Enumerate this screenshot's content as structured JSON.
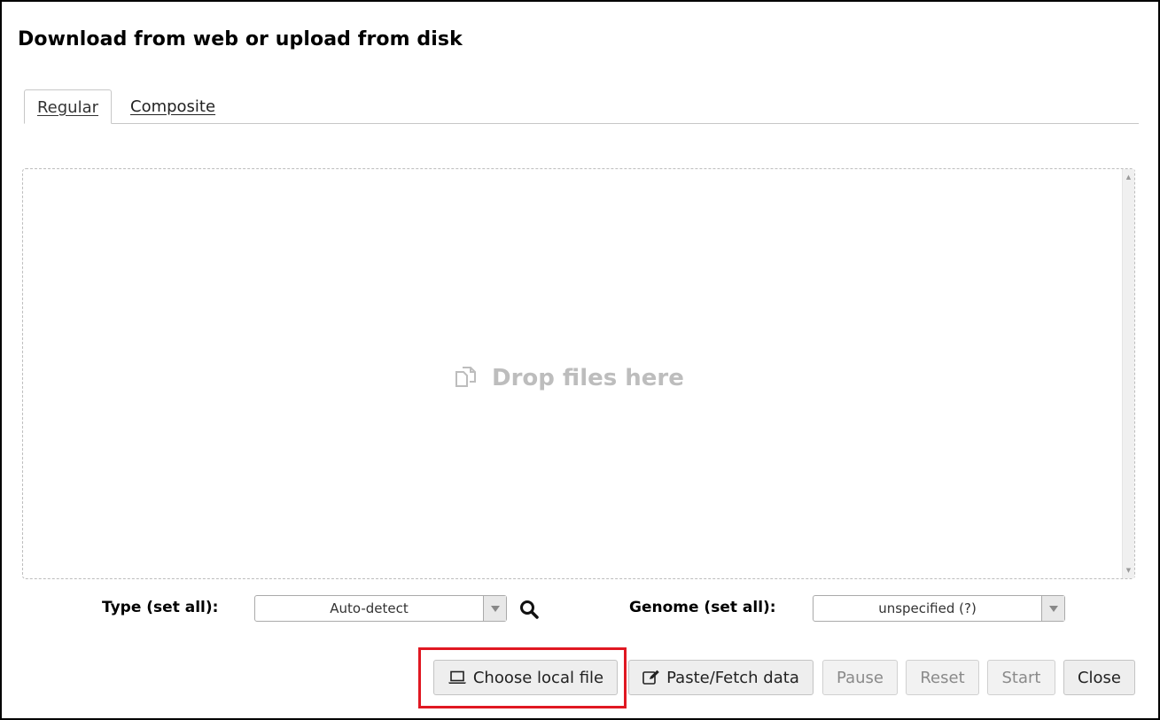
{
  "dialog": {
    "title": "Download from web or upload from disk"
  },
  "tabs": [
    {
      "label": "Regular",
      "active": true
    },
    {
      "label": "Composite",
      "active": false
    }
  ],
  "dropzone": {
    "hint": "Drop files here",
    "icon": "copy-files-icon"
  },
  "type_setting": {
    "label": "Type (set all):",
    "value": "Auto-detect",
    "search_icon": "search-icon"
  },
  "genome_setting": {
    "label": "Genome (set all):",
    "value": "unspecified (?)"
  },
  "buttons": {
    "choose_local_file": "Choose local file",
    "paste_fetch": "Paste/Fetch data",
    "pause": "Pause",
    "reset": "Reset",
    "start": "Start",
    "close": "Close"
  },
  "colors": {
    "highlight": "#e01822",
    "hint_text": "#bdbdbd",
    "button_bg": "#eeeeee"
  }
}
